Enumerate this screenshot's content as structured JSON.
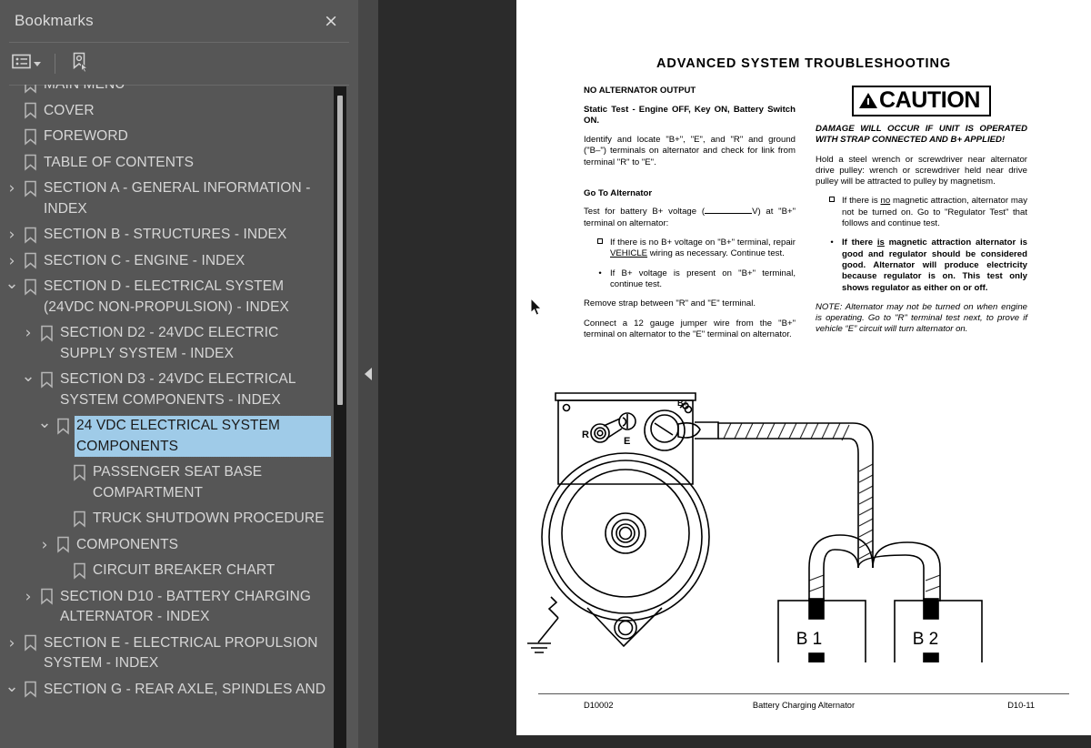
{
  "panel": {
    "title": "Bookmarks",
    "close_label": "×",
    "toolbar": {
      "options_icon": "list-options-icon",
      "caret_icon": "chevron-down-icon",
      "new_bookmark_icon": "new-bookmark-icon"
    },
    "collapse_icon": "triangle-left-icon"
  },
  "bookmarks": [
    {
      "label": "MAIN MENU",
      "indent": 0,
      "twisty": "",
      "selected": false
    },
    {
      "label": "COVER",
      "indent": 0,
      "twisty": "",
      "selected": false
    },
    {
      "label": "FOREWORD",
      "indent": 0,
      "twisty": "",
      "selected": false
    },
    {
      "label": "TABLE OF CONTENTS",
      "indent": 0,
      "twisty": "",
      "selected": false
    },
    {
      "label": "SECTION A - GENERAL INFORMATION - INDEX",
      "indent": 0,
      "twisty": "collapsed",
      "selected": false
    },
    {
      "label": "SECTION B - STRUCTURES - INDEX",
      "indent": 0,
      "twisty": "collapsed",
      "selected": false
    },
    {
      "label": "SECTION C - ENGINE - INDEX",
      "indent": 0,
      "twisty": "collapsed",
      "selected": false
    },
    {
      "label": "SECTION D - ELECTRICAL SYSTEM (24VDC NON-PROPULSION) - INDEX",
      "indent": 0,
      "twisty": "expanded",
      "selected": false
    },
    {
      "label": "SECTION D2 - 24VDC ELECTRIC SUPPLY SYSTEM - INDEX",
      "indent": 1,
      "twisty": "collapsed",
      "selected": false
    },
    {
      "label": "SECTION D3 - 24VDC ELECTRICAL SYSTEM COMPONENTS - INDEX",
      "indent": 1,
      "twisty": "expanded",
      "selected": false
    },
    {
      "label": "24 VDC ELECTRICAL SYSTEM COMPONENTS",
      "indent": 2,
      "twisty": "expanded",
      "selected": true
    },
    {
      "label": "PASSENGER SEAT BASE COMPARTMENT",
      "indent": 3,
      "twisty": "",
      "selected": false
    },
    {
      "label": "TRUCK SHUTDOWN PROCEDURE",
      "indent": 3,
      "twisty": "",
      "selected": false
    },
    {
      "label": "COMPONENTS",
      "indent": 2,
      "twisty": "collapsed",
      "selected": false
    },
    {
      "label": "CIRCUIT BREAKER CHART",
      "indent": 3,
      "twisty": "",
      "selected": false
    },
    {
      "label": "SECTION D10 - BATTERY CHARGING ALTERNATOR - INDEX",
      "indent": 1,
      "twisty": "collapsed",
      "selected": false
    },
    {
      "label": "SECTION E - ELECTRICAL PROPULSION SYSTEM - INDEX",
      "indent": 0,
      "twisty": "collapsed",
      "selected": false
    },
    {
      "label": "SECTION G - REAR AXLE, SPINDLES AND",
      "indent": 0,
      "twisty": "expanded",
      "selected": false
    }
  ],
  "document": {
    "title": "ADVANCED SYSTEM TROUBLESHOOTING",
    "left_column": {
      "heading": "NO ALTERNATOR OUTPUT",
      "static_test_heading": "Static Test - Engine OFF, Key ON, Battery Switch ON.",
      "intro": "Identify and locate \"B+\", \"E\", and \"R\" and ground (\"B–\") terminals on alternator and check for link from terminal \"R\" to \"E\".",
      "go_to_heading": "Go To Alternator",
      "test_intro_a": "Test for battery B+ voltage (",
      "test_intro_b": "V) at \"B+\" terminal on alternator:",
      "bullet1_pre": "If there is no B+ voltage on \"B+\" terminal, repair ",
      "bullet1_underline": "VEHICLE",
      "bullet1_post": " wiring as necessary. Continue test.",
      "bullet2": "If B+ voltage is present on \"B+\" terminal, continue test.",
      "para_remove": "Remove strap between \"R\" and \"E\" terminal.",
      "para_connect": "Connect a 12 gauge jumper wire from the \"B+\" terminal on alternator to the \"E\" terminal on alternator."
    },
    "right_column": {
      "caution_word": "CAUTION",
      "caution_icon": "warning-triangle-icon",
      "caution_text": "DAMAGE WILL OCCUR IF UNIT IS OPERATED WITH STRAP CONNECTED AND B+ APPLIED!",
      "hold_para": "Hold a steel wrench or screwdriver near alternator drive pulley: wrench or screwdriver held near drive pulley will be attracted to pulley by magnetism.",
      "bullet1_pre": "If there is ",
      "bullet1_underline": "no",
      "bullet1_post": " magnetic attraction, alternator may not be turned on. Go to \"Regulator Test\" that follows and continue test.",
      "bullet2_pre": "If there ",
      "bullet2_underline": "is",
      "bullet2_post": " magnetic attraction alternator is good and regulator should be considered good. Alternator will produce electricity because regulator is on. This test only shows regulator as either on or off.",
      "note": "NOTE: Alternator may not be turned on when engine is operating. Go to \"R\" terminal test next, to prove if vehicle “E” circuit will turn alternator on."
    },
    "figure": {
      "name": "alternator-battery-wiring-diagram",
      "terminal_r": "R",
      "terminal_e": "E",
      "terminal_bplus": "B+",
      "battery1": "B 1",
      "battery2": "B 2"
    },
    "footer": {
      "left": "D10002",
      "center": "Battery Charging Alternator",
      "right": "D10-11"
    }
  },
  "colors": {
    "panel_bg": "#565656",
    "viewer_bg": "#2b2b2b",
    "selection": "#9fcbe8",
    "text": "#d7d7d7"
  }
}
